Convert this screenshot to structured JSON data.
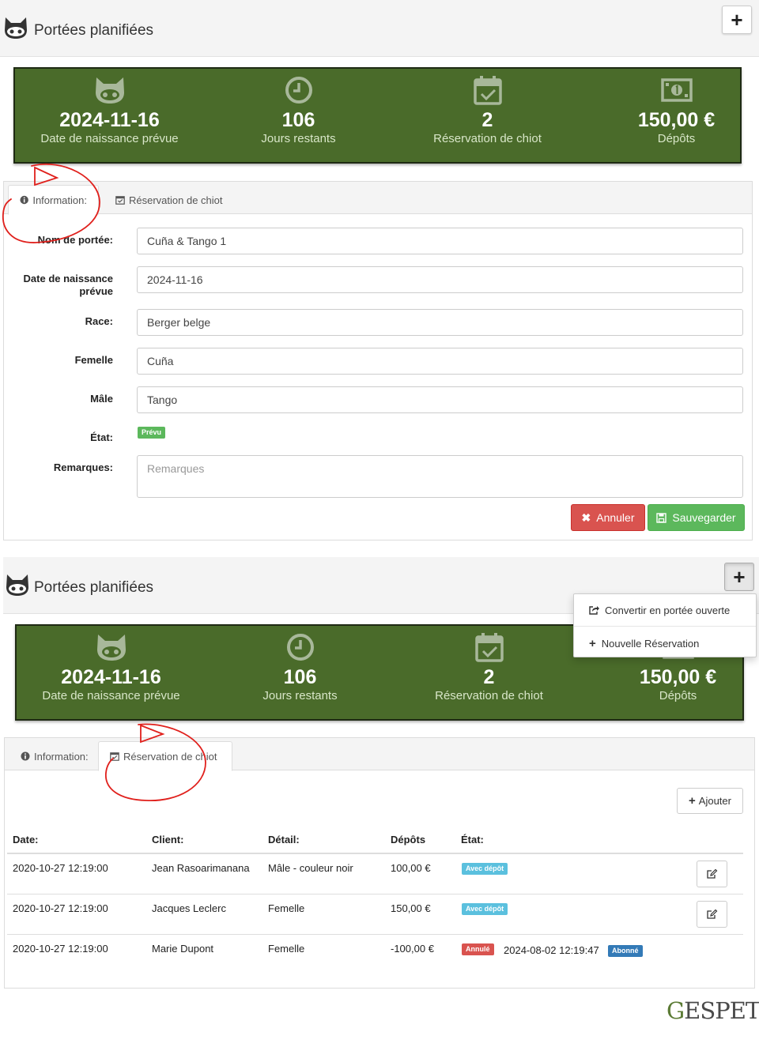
{
  "header": {
    "title": "Portées planifiées"
  },
  "stats": [
    {
      "icon": "cat-face-icon",
      "value": "2024-11-16",
      "label": "Date de naissance prévue"
    },
    {
      "icon": "clock-icon",
      "value": "106",
      "label": "Jours restants"
    },
    {
      "icon": "calendar-check-icon",
      "value": "2",
      "label": "Réservation de chiot"
    },
    {
      "icon": "money-icon",
      "value": "150,00 €",
      "label": "Dépôts"
    }
  ],
  "tabs": {
    "information": "Information:",
    "reservation": "Réservation de chiot"
  },
  "form": {
    "nom_label": "Nom de portée:",
    "nom_value": "Cuña & Tango 1",
    "date_label_1": "Date de naissance",
    "date_label_2": "prévue",
    "date_value": "2024-11-16",
    "race_label": "Race:",
    "race_value": "Berger belge",
    "femelle_label": "Femelle",
    "femelle_value": "Cuña",
    "male_label": "Mâle",
    "male_value": "Tango",
    "etat_label": "État:",
    "etat_badge": "Prévu",
    "remarques_label": "Remarques:",
    "remarques_placeholder": "Remarques",
    "cancel_label": "Annuler",
    "save_label": "Sauvegarder"
  },
  "dropdown": {
    "convert_label": "Convertir en portée ouverte",
    "new_label": "Nouvelle Réservation"
  },
  "reservations": {
    "add_label": "Ajouter",
    "headers": {
      "date": "Date:",
      "client": "Client:",
      "detail": "Détail:",
      "depots": "Dépôts",
      "etat": "État:"
    },
    "rows": [
      {
        "date": "2020-10-27 12:19:00",
        "client": "Jean Rasoarimanana",
        "detail": "Mâle - couleur noir",
        "depots": "100,00 €",
        "badge": "Avec dépôt"
      },
      {
        "date": "2020-10-27 12:19:00",
        "client": "Jacques Leclerc",
        "detail": "Femelle",
        "depots": "150,00 €",
        "badge": "Avec dépôt"
      },
      {
        "date": "2020-10-27 12:19:00",
        "client": "Marie Dupont",
        "detail": "Femelle",
        "depots": "-100,00 €",
        "badge": "Annulé",
        "cancel_date": "2024-08-02 12:19:47",
        "badge2": "Abonné"
      }
    ]
  },
  "brand": {
    "first": "G",
    "rest": "ESPET"
  },
  "colors": {
    "stats_bg": "#4a6b2a",
    "success": "#5cb85c",
    "danger": "#d9534f",
    "info": "#5bc0de",
    "primary": "#337ab7",
    "annotation": "#e0201c"
  }
}
